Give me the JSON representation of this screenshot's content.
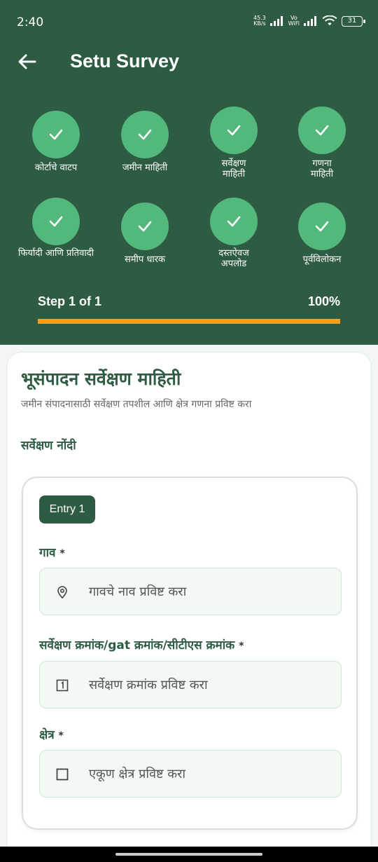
{
  "status_bar": {
    "time": "2:40",
    "net_speed_value": "45.3",
    "net_speed_unit": "KB/s",
    "volte_top": "Vo",
    "volte_bottom": "WiFi",
    "battery": "31"
  },
  "header": {
    "title": "Setu Survey"
  },
  "steps": [
    {
      "label": "कोर्टाचे वाटप"
    },
    {
      "label": "जमीन माहिती"
    },
    {
      "label": "सर्वेक्षण माहिती"
    },
    {
      "label": "गणना माहिती"
    },
    {
      "label": "फिर्यादी आणि प्रतिवादी"
    },
    {
      "label": "समीप धारक"
    },
    {
      "label": "दस्तऐवज अपलोड"
    },
    {
      "label": "पूर्वविलोकन"
    }
  ],
  "progress": {
    "step_text": "Step 1 of 1",
    "percent_text": "100%",
    "value": 1.0
  },
  "card": {
    "title": "भूसंपादन सर्वेक्षण माहिती",
    "subtitle": "जमीन संपादनासाठी सर्वेक्षण तपशील आणि क्षेत्र गणना प्रविष्ट करा",
    "section_title": "सर्वेक्षण नोंदी",
    "entry": {
      "badge": "Entry 1",
      "fields": [
        {
          "label": "गाव",
          "required_mark": "*",
          "placeholder": "गावचे नाव प्रविष्ट करा",
          "icon": "location-pin-icon"
        },
        {
          "label": "सर्वेक्षण क्रमांक/gat क्रमांक/सीटीएस क्रमांक",
          "required_mark": "*",
          "placeholder": "सर्वेक्षण क्रमांक प्रविष्ट करा",
          "icon": "number-box-icon"
        },
        {
          "label": "क्षेत्र",
          "required_mark": "*",
          "placeholder": "एकूण क्षेत्र प्रविष्ट करा",
          "icon": "square-icon"
        }
      ]
    }
  },
  "colors": {
    "header_bg": "#2e5c42",
    "step_circle": "#52b87c",
    "progress_fill": "#f5a01a",
    "accent_text": "#2e5c42"
  }
}
